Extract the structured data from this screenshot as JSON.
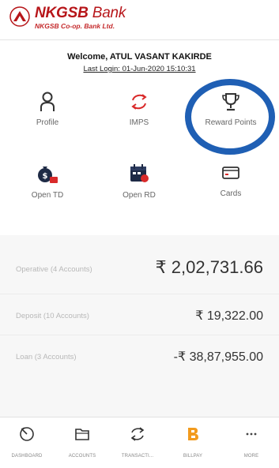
{
  "header": {
    "brand_primary": "NKGSB",
    "brand_secondary": "Bank",
    "brand_sub": "NKGSB Co-op. Bank Ltd."
  },
  "welcome": {
    "greeting": "Welcome, ATUL VASANT KAKIRDE",
    "last_login": "Last Login: 01-Jun-2020 15:10:31"
  },
  "tiles": [
    {
      "label": "Profile",
      "icon": "person-icon"
    },
    {
      "label": "IMPS",
      "icon": "transfer-icon"
    },
    {
      "label": "Reward Points",
      "icon": "trophy-icon"
    },
    {
      "label": "Open TD",
      "icon": "deposit-icon"
    },
    {
      "label": "Open RD",
      "icon": "calendar-icon"
    },
    {
      "label": "Cards",
      "icon": "card-icon"
    }
  ],
  "accounts": [
    {
      "name": "Operative (4 Accounts)",
      "amount": "₹ 2,02,731.66"
    },
    {
      "name": "Deposit (10 Accounts)",
      "amount": "₹ 19,322.00"
    },
    {
      "name": "Loan (3 Accounts)",
      "amount": "-₹ 38,87,955.00"
    }
  ],
  "bottom_nav": [
    {
      "label": "DASHBOARD",
      "icon": "dashboard-icon"
    },
    {
      "label": "ACCOUNTS",
      "icon": "folder-icon"
    },
    {
      "label": "TRANSACTI...",
      "icon": "transaction-icon"
    },
    {
      "label": "BILLPAY",
      "icon": "billpay-icon"
    },
    {
      "label": "MORE",
      "icon": "more-icon"
    }
  ],
  "colors": {
    "brand_red": "#b7161a",
    "highlight_ring": "#1f5fb4",
    "billpay_orange": "#f29a1d"
  }
}
